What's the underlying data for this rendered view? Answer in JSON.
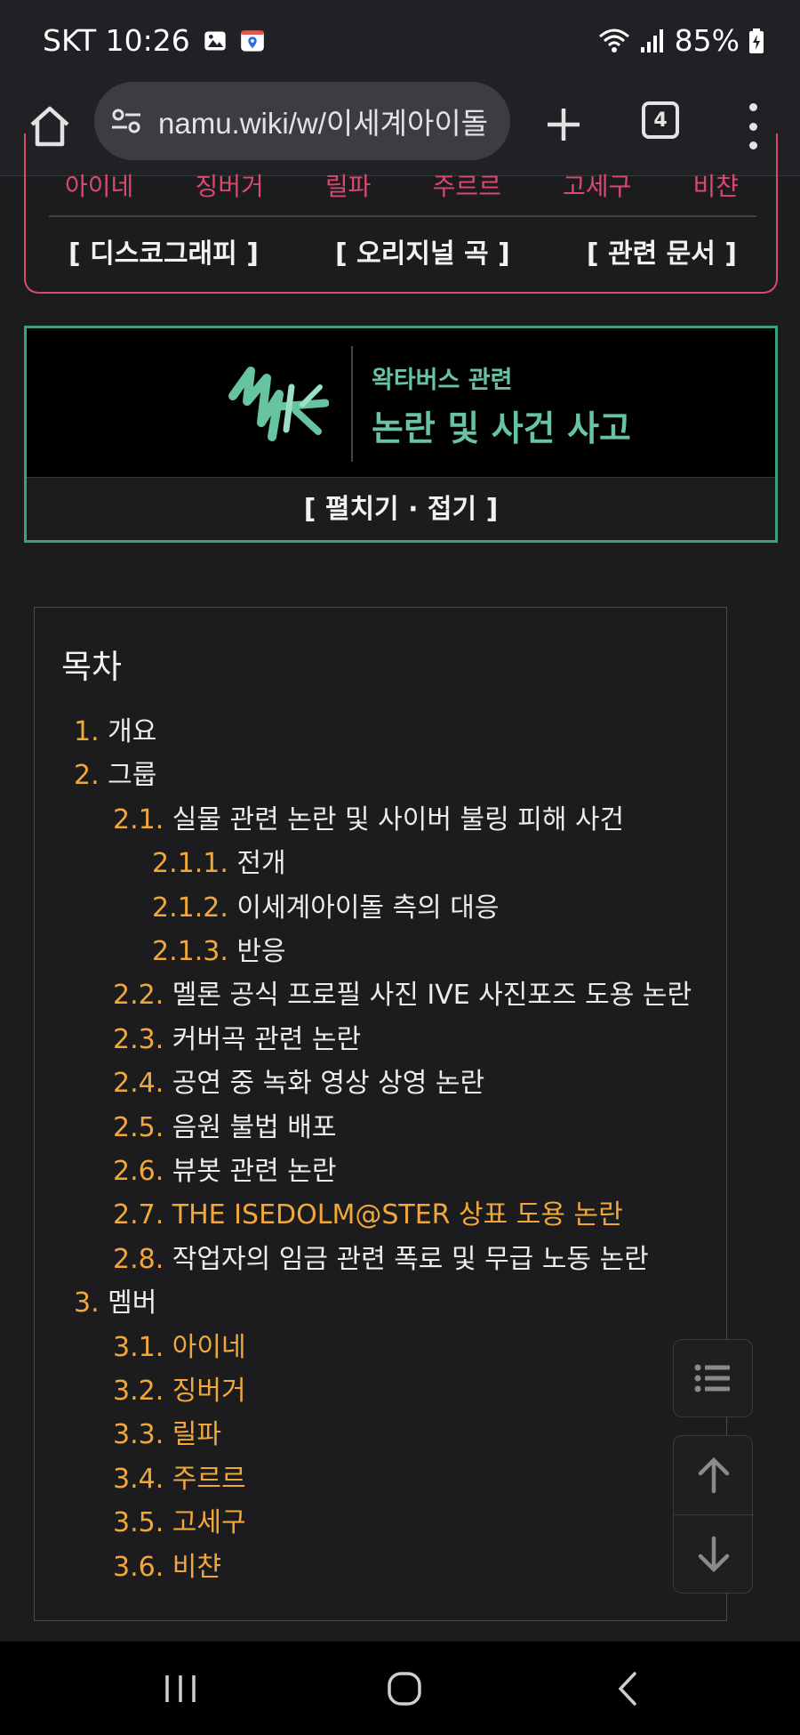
{
  "status_bar": {
    "carrier_time": "SKT 10:26",
    "battery": "85%",
    "icons": [
      "gallery-icon",
      "maps-icon",
      "wifi-icon",
      "signal-icon",
      "battery-charging-icon"
    ]
  },
  "browser": {
    "url": "namu.wiki/w/이세계아이돌",
    "tab_count": "4",
    "icons": [
      "home-icon",
      "site-settings-icon",
      "new-tab-icon",
      "tabs-icon",
      "more-icon"
    ]
  },
  "nav_box": {
    "members": [
      "아이네",
      "징버거",
      "릴파",
      "주르르",
      "고세구",
      "비챤"
    ],
    "links": [
      "[ 디스코그래피 ]",
      "[ 오리지널 곡 ]",
      "[ 관련 문서 ]"
    ]
  },
  "controversy_box": {
    "subtitle": "왁타버스 관련",
    "title": "논란 및 사건 사고",
    "toggle": "[ 펼치기 · 접기 ]"
  },
  "toc": {
    "title": "목차",
    "items": [
      {
        "num": "1.",
        "text": "개요",
        "level": 0,
        "link": false
      },
      {
        "num": "2.",
        "text": "그룹",
        "level": 0,
        "link": false
      },
      {
        "num": "2.1.",
        "text": "실물 관련 논란 및 사이버 불링 피해 사건",
        "level": 1,
        "link": false
      },
      {
        "num": "2.1.1.",
        "text": "전개",
        "level": 2,
        "link": false
      },
      {
        "num": "2.1.2.",
        "text": "이세계아이돌 측의 대응",
        "level": 2,
        "link": false
      },
      {
        "num": "2.1.3.",
        "text": "반응",
        "level": 2,
        "link": false
      },
      {
        "num": "2.2.",
        "text": "멜론 공식 프로필 사진 IVE 사진포즈 도용 논란",
        "level": 1,
        "link": false
      },
      {
        "num": "2.3.",
        "text": "커버곡 관련 논란",
        "level": 1,
        "link": false
      },
      {
        "num": "2.4.",
        "text": "공연 중 녹화 영상 상영 논란",
        "level": 1,
        "link": false
      },
      {
        "num": "2.5.",
        "text": "음원 불법 배포",
        "level": 1,
        "link": false
      },
      {
        "num": "2.6.",
        "text": "뷰봇 관련 논란",
        "level": 1,
        "link": false
      },
      {
        "num": "2.7.",
        "text": "THE ISEDOLM@STER 상표 도용 논란",
        "level": 1,
        "link": true
      },
      {
        "num": "2.8.",
        "text": "작업자의 임금 관련 폭로 및 무급 노동 논란",
        "level": 1,
        "link": false
      },
      {
        "num": "3.",
        "text": "멤버",
        "level": 0,
        "link": false
      },
      {
        "num": "3.1.",
        "text": "아이네",
        "level": 1,
        "link": true
      },
      {
        "num": "3.2.",
        "text": "징버거",
        "level": 1,
        "link": true
      },
      {
        "num": "3.3.",
        "text": "릴파",
        "level": 1,
        "link": true
      },
      {
        "num": "3.4.",
        "text": "주르르",
        "level": 1,
        "link": true
      },
      {
        "num": "3.5.",
        "text": "고세구",
        "level": 1,
        "link": true
      },
      {
        "num": "3.6.",
        "text": "비챤",
        "level": 1,
        "link": true
      }
    ]
  },
  "floating_buttons": [
    "toc-list-icon",
    "arrow-up-icon",
    "arrow-down-icon"
  ],
  "android_nav": [
    "recents-icon",
    "home-circle-icon",
    "back-icon"
  ],
  "colors": {
    "background": "#1c1c1e",
    "toc_number": "#f0a83c",
    "member_link": "#d9486d",
    "accent_green": "#67c4a1",
    "box_border_green": "#3c9f7f"
  }
}
